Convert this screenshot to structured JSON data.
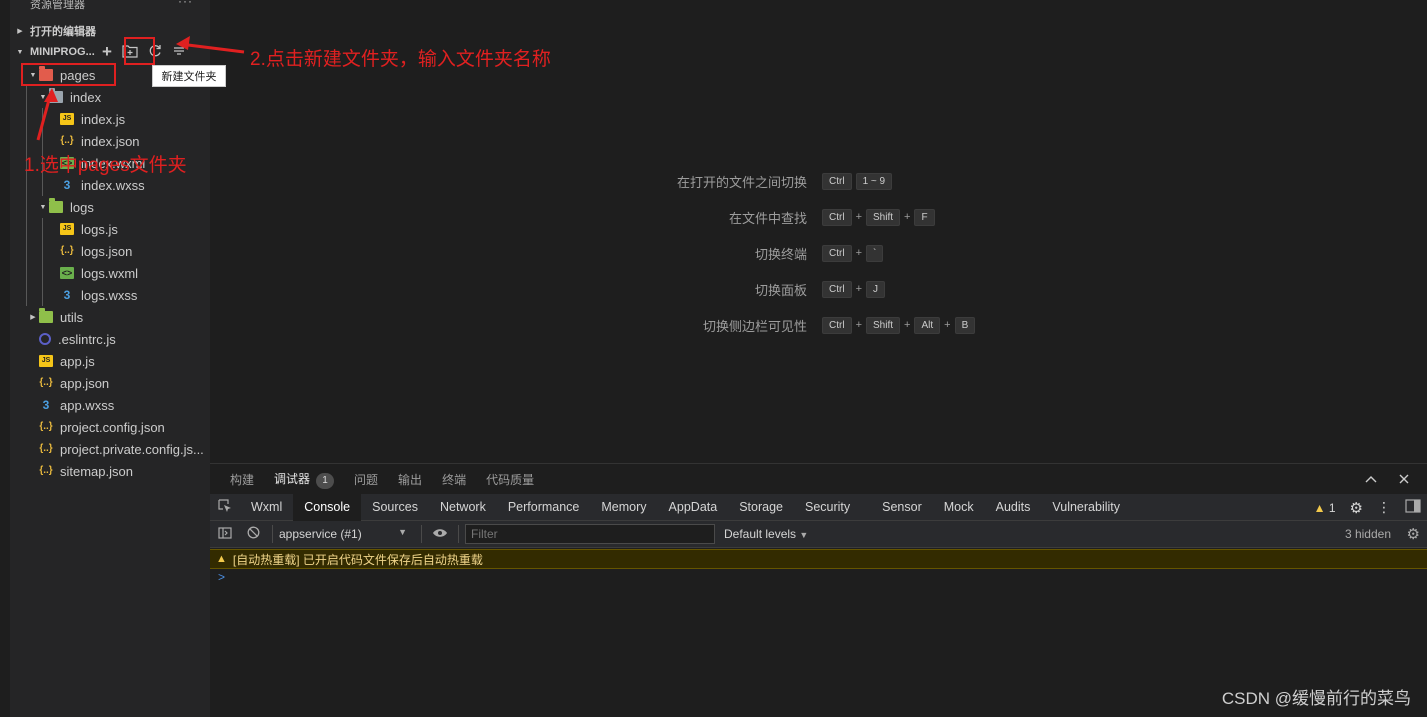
{
  "sidebar": {
    "title": "资源管理器",
    "more": "···",
    "open_editors": "打开的编辑器",
    "project": "MINIPROG...",
    "tooltip": "新建文件夹",
    "tree": [
      {
        "label": "pages",
        "icon": "folder-red-icon",
        "expanded": true
      },
      {
        "label": "index",
        "icon": "folder-icon",
        "expanded": true
      },
      {
        "label": "index.js",
        "icon": "js-file-icon"
      },
      {
        "label": "index.json",
        "icon": "json-file-icon"
      },
      {
        "label": "index.wxml",
        "icon": "wxml-file-icon"
      },
      {
        "label": "index.wxss",
        "icon": "wxss-file-icon"
      },
      {
        "label": "logs",
        "icon": "folder-green-icon",
        "expanded": true
      },
      {
        "label": "logs.js",
        "icon": "js-file-icon"
      },
      {
        "label": "logs.json",
        "icon": "json-file-icon"
      },
      {
        "label": "logs.wxml",
        "icon": "wxml-file-icon"
      },
      {
        "label": "logs.wxss",
        "icon": "wxss-file-icon"
      },
      {
        "label": "utils",
        "icon": "folder-green-icon",
        "expanded": false
      },
      {
        "label": ".eslintrc.js",
        "icon": "eslint-icon"
      },
      {
        "label": "app.js",
        "icon": "js-file-icon"
      },
      {
        "label": "app.json",
        "icon": "json-file-icon"
      },
      {
        "label": "app.wxss",
        "icon": "wxss-file-icon"
      },
      {
        "label": "project.config.json",
        "icon": "json-file-icon"
      },
      {
        "label": "project.private.config.js...",
        "icon": "json-file-icon"
      },
      {
        "label": "sitemap.json",
        "icon": "json-file-icon"
      }
    ]
  },
  "annotations": {
    "step1": "1.选中pages文件夹",
    "step2": "2.点击新建文件夹，输入文件夹名称",
    "color": "#e02020"
  },
  "shortcuts": [
    {
      "label": "在打开的文件之间切换",
      "keys": [
        "Ctrl",
        "1 ~ 9"
      ]
    },
    {
      "label": "在文件中查找",
      "keys": [
        "Ctrl",
        "+",
        "Shift",
        "+",
        "F"
      ]
    },
    {
      "label": "切换终端",
      "keys": [
        "Ctrl",
        "+",
        "`"
      ]
    },
    {
      "label": "切换面板",
      "keys": [
        "Ctrl",
        "+",
        "J"
      ]
    },
    {
      "label": "切换侧边栏可见性",
      "keys": [
        "Ctrl",
        "+",
        "Shift",
        "+",
        "Alt",
        "+",
        "B"
      ]
    }
  ],
  "panel": {
    "tabs": [
      {
        "label": "构建",
        "active": false
      },
      {
        "label": "调试器",
        "active": true,
        "badge": "1"
      },
      {
        "label": "问题",
        "active": false
      },
      {
        "label": "输出",
        "active": false
      },
      {
        "label": "终端",
        "active": false
      },
      {
        "label": "代码质量",
        "active": false
      }
    ],
    "devtools_tabs": [
      "Wxml",
      "Console",
      "Sources",
      "Network",
      "Performance",
      "Memory",
      "AppData",
      "Storage",
      "Security",
      "Sensor",
      "Mock",
      "Audits",
      "Vulnerability"
    ],
    "devtools_active": "Console",
    "warning_count": "1",
    "context": "appservice (#1)",
    "filter_placeholder": "Filter",
    "levels": "Default levels",
    "hidden": "3 hidden",
    "console_message": "[自动热重载] 已开启代码文件保存后自动热重载",
    "prompt": ">"
  },
  "watermark": "CSDN @缓慢前行的菜鸟"
}
